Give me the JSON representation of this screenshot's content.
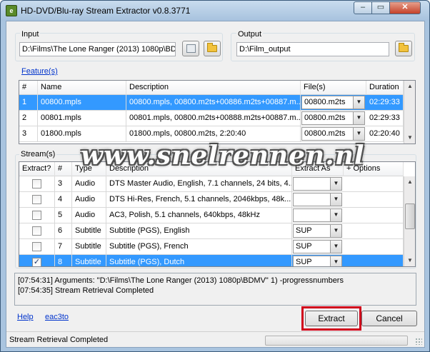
{
  "window": {
    "title": "HD-DVD/Blu-ray Stream Extractor v0.8.3771",
    "app_icon_glyph": "e",
    "controls": {
      "minimize": "–",
      "maximize": "▭",
      "close": "✕"
    }
  },
  "input": {
    "label": "Input",
    "value": "D:\\Films\\The Lone Ranger (2013) 1080p\\BD"
  },
  "output": {
    "label": "Output",
    "value": "D:\\Film_output"
  },
  "features": {
    "link": "Feature(s)",
    "columns": [
      "#",
      "Name",
      "Description",
      "File(s)",
      "Duration"
    ],
    "rows": [
      {
        "num": "1",
        "name": "00800.mpls",
        "description": "00800.mpls, 00800.m2ts+00886.m2ts+00887.m...",
        "file": "00800.m2ts",
        "duration": "02:29:33",
        "selected": true
      },
      {
        "num": "2",
        "name": "00801.mpls",
        "description": "00801.mpls, 00800.m2ts+00888.m2ts+00887.m...",
        "file": "00800.m2ts",
        "duration": "02:29:33",
        "selected": false
      },
      {
        "num": "3",
        "name": "01800.mpls",
        "description": "01800.mpls, 00800.m2ts, 2:20:40",
        "file": "00800.m2ts",
        "duration": "02:20:40",
        "selected": false
      }
    ]
  },
  "streams": {
    "label": "Stream(s)",
    "columns": [
      "Extract?",
      "#",
      "Type",
      "Description",
      "Extract As",
      "+ Options"
    ],
    "rows": [
      {
        "checked": false,
        "num": "3",
        "type": "Audio",
        "description": "DTS Master Audio, English, 7.1 channels, 24 bits, 4...",
        "extract_as": "",
        "selected": false
      },
      {
        "checked": false,
        "num": "4",
        "type": "Audio",
        "description": "DTS Hi-Res, French, 5.1 channels, 2046kbps, 48k...",
        "extract_as": "",
        "selected": false
      },
      {
        "checked": false,
        "num": "5",
        "type": "Audio",
        "description": "AC3, Polish, 5.1 channels, 640kbps, 48kHz",
        "extract_as": "",
        "selected": false
      },
      {
        "checked": false,
        "num": "6",
        "type": "Subtitle",
        "description": "Subtitle (PGS), English",
        "extract_as": "SUP",
        "selected": false
      },
      {
        "checked": false,
        "num": "7",
        "type": "Subtitle",
        "description": "Subtitle (PGS), French",
        "extract_as": "SUP",
        "selected": false
      },
      {
        "checked": true,
        "num": "8",
        "type": "Subtitle",
        "description": "Subtitle (PGS), Dutch",
        "extract_as": "SUP",
        "selected": true
      }
    ]
  },
  "log": {
    "lines": [
      "[07:54:31] Arguments: \"D:\\Films\\The Lone Ranger (2013) 1080p\\BDMV\" 1) -progressnumbers",
      "[07:54:35] Stream Retrieval Completed"
    ]
  },
  "links": {
    "help": "Help",
    "eac3to": "eac3to"
  },
  "buttons": {
    "extract": "Extract",
    "cancel": "Cancel"
  },
  "status": {
    "text": "Stream Retrieval Completed",
    "progress": 0
  },
  "watermark": "www.snelrennen.nl",
  "colors": {
    "selection": "#3399ff",
    "highlight_box": "#d0021b",
    "link": "#0033cc"
  }
}
